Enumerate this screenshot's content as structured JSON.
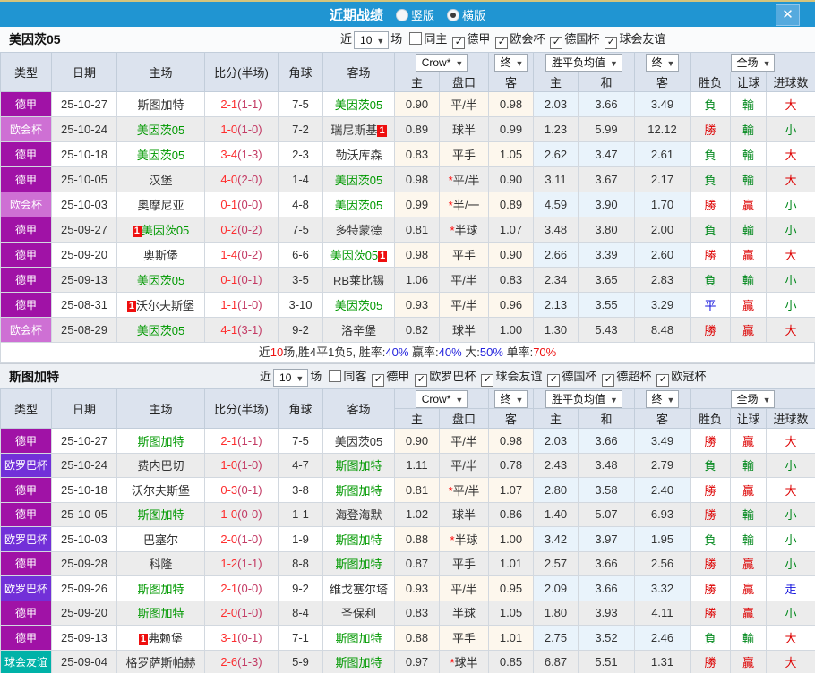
{
  "icons": {
    "dropdown_arrow": "▼",
    "close": "✕",
    "check": "✓"
  },
  "colors": {
    "topbar": "#2095d2",
    "topbar_strip": "#d5c47b",
    "close_button": "#55aade",
    "focus_team_green": "#009900",
    "score_red": "#ff2d2d",
    "half_score": "#c33a64",
    "win_red": "#dd0000",
    "lose_green": "#00881b",
    "draw_blue": "#1515dd",
    "league_colors": {
      "德甲": "#a012a6",
      "欧会杯": "#ce70d4",
      "欧罗巴杯": "#7230d8",
      "球会友谊": "#00b2a8"
    }
  },
  "topbar": {
    "title": "近期战绩",
    "options": [
      {
        "label": "竖版",
        "selected": false
      },
      {
        "label": "横版",
        "selected": true
      }
    ]
  },
  "columns_left": [
    "类型",
    "日期",
    "主场",
    "比分(半场)",
    "角球",
    "客场"
  ],
  "columns_right": [
    "主",
    "盘口",
    "客",
    "主",
    "和",
    "客",
    "胜负",
    "让球",
    "进球数"
  ],
  "header_dropdowns": [
    "Crow*",
    "终",
    "胜平负均值",
    "终",
    "全场"
  ],
  "tables": [
    {
      "team": "美因茨05",
      "filter": {
        "near": "近",
        "count": "10",
        "games": "场",
        "same": {
          "label": "同主",
          "checked": false
        },
        "leagues": [
          {
            "label": "德甲",
            "checked": true
          },
          {
            "label": "欧会杯",
            "checked": true
          },
          {
            "label": "德国杯",
            "checked": true
          },
          {
            "label": "球会友谊",
            "checked": true
          }
        ]
      },
      "rows": [
        {
          "type": "德甲",
          "date": "25-10-27",
          "home": "斯图加特",
          "home_focus": false,
          "home_card": false,
          "score": "2-1",
          "half": "(1-1)",
          "corners": "7-5",
          "away": "美因茨05",
          "away_focus": true,
          "away_card": false,
          "odds": [
            "0.90",
            "平/半",
            "0.98"
          ],
          "handicap_star": false,
          "avg": [
            "2.03",
            "3.66",
            "3.49"
          ],
          "results": [
            "負",
            "輸",
            "大"
          ]
        },
        {
          "type": "欧会杯",
          "date": "25-10-24",
          "home": "美因茨05",
          "home_focus": true,
          "home_card": false,
          "score": "1-0",
          "half": "(1-0)",
          "corners": "7-2",
          "away": "瑞尼斯基",
          "away_focus": false,
          "away_card": true,
          "odds": [
            "0.89",
            "球半",
            "0.99"
          ],
          "handicap_star": false,
          "avg": [
            "1.23",
            "5.99",
            "12.12"
          ],
          "results": [
            "勝",
            "輸",
            "小"
          ]
        },
        {
          "type": "德甲",
          "date": "25-10-18",
          "home": "美因茨05",
          "home_focus": true,
          "home_card": false,
          "score": "3-4",
          "half": "(1-3)",
          "corners": "2-3",
          "away": "勒沃库森",
          "away_focus": false,
          "away_card": false,
          "odds": [
            "0.83",
            "平手",
            "1.05"
          ],
          "handicap_star": false,
          "avg": [
            "2.62",
            "3.47",
            "2.61"
          ],
          "results": [
            "負",
            "輸",
            "大"
          ]
        },
        {
          "type": "德甲",
          "date": "25-10-05",
          "home": "汉堡",
          "home_focus": false,
          "home_card": false,
          "score": "4-0",
          "half": "(2-0)",
          "corners": "1-4",
          "away": "美因茨05",
          "away_focus": true,
          "away_card": false,
          "odds": [
            "0.98",
            "平/半",
            "0.90"
          ],
          "handicap_star": true,
          "avg": [
            "3.11",
            "3.67",
            "2.17"
          ],
          "results": [
            "負",
            "輸",
            "大"
          ]
        },
        {
          "type": "欧会杯",
          "date": "25-10-03",
          "home": "奥摩尼亚",
          "home_focus": false,
          "home_card": false,
          "score": "0-1",
          "half": "(0-0)",
          "corners": "4-8",
          "away": "美因茨05",
          "away_focus": true,
          "away_card": false,
          "odds": [
            "0.99",
            "半/一",
            "0.89"
          ],
          "handicap_star": true,
          "avg": [
            "4.59",
            "3.90",
            "1.70"
          ],
          "results": [
            "勝",
            "贏",
            "小"
          ]
        },
        {
          "type": "德甲",
          "date": "25-09-27",
          "home": "美因茨05",
          "home_focus": true,
          "home_card": true,
          "score": "0-2",
          "half": "(0-2)",
          "corners": "7-5",
          "away": "多特蒙德",
          "away_focus": false,
          "away_card": false,
          "odds": [
            "0.81",
            "半球",
            "1.07"
          ],
          "handicap_star": true,
          "avg": [
            "3.48",
            "3.80",
            "2.00"
          ],
          "results": [
            "負",
            "輸",
            "小"
          ]
        },
        {
          "type": "德甲",
          "date": "25-09-20",
          "home": "奥斯堡",
          "home_focus": false,
          "home_card": false,
          "score": "1-4",
          "half": "(0-2)",
          "corners": "6-6",
          "away": "美因茨05",
          "away_focus": true,
          "away_card": true,
          "odds": [
            "0.98",
            "平手",
            "0.90"
          ],
          "handicap_star": false,
          "avg": [
            "2.66",
            "3.39",
            "2.60"
          ],
          "results": [
            "勝",
            "贏",
            "大"
          ]
        },
        {
          "type": "德甲",
          "date": "25-09-13",
          "home": "美因茨05",
          "home_focus": true,
          "home_card": false,
          "score": "0-1",
          "half": "(0-1)",
          "corners": "3-5",
          "away": "RB莱比锡",
          "away_focus": false,
          "away_card": false,
          "odds": [
            "1.06",
            "平/半",
            "0.83"
          ],
          "handicap_star": false,
          "avg": [
            "2.34",
            "3.65",
            "2.83"
          ],
          "results": [
            "負",
            "輸",
            "小"
          ]
        },
        {
          "type": "德甲",
          "date": "25-08-31",
          "home": "沃尔夫斯堡",
          "home_focus": false,
          "home_card": true,
          "score": "1-1",
          "half": "(1-0)",
          "corners": "3-10",
          "away": "美因茨05",
          "away_focus": true,
          "away_card": false,
          "odds": [
            "0.93",
            "平/半",
            "0.96"
          ],
          "handicap_star": false,
          "avg": [
            "2.13",
            "3.55",
            "3.29"
          ],
          "results": [
            "平",
            "贏",
            "小"
          ]
        },
        {
          "type": "欧会杯",
          "date": "25-08-29",
          "home": "美因茨05",
          "home_focus": true,
          "home_card": false,
          "score": "4-1",
          "half": "(3-1)",
          "corners": "9-2",
          "away": "洛辛堡",
          "away_focus": false,
          "away_card": false,
          "odds": [
            "0.82",
            "球半",
            "1.00"
          ],
          "handicap_star": false,
          "avg": [
            "1.30",
            "5.43",
            "8.48"
          ],
          "results": [
            "勝",
            "贏",
            "大"
          ]
        }
      ],
      "summary": [
        {
          "text": "近",
          "color": "black"
        },
        {
          "text": "10",
          "color": "red"
        },
        {
          "text": "场,胜4平1负5, 胜率:",
          "color": "black"
        },
        {
          "text": "40%",
          "color": "blue"
        },
        {
          "text": " 赢率:",
          "color": "black"
        },
        {
          "text": "40%",
          "color": "blue"
        },
        {
          "text": " 大:",
          "color": "black"
        },
        {
          "text": "50%",
          "color": "blue"
        },
        {
          "text": " 单率:",
          "color": "black"
        },
        {
          "text": "70%",
          "color": "red"
        }
      ]
    },
    {
      "team": "斯图加特",
      "filter": {
        "near": "近",
        "count": "10",
        "games": "场",
        "same": {
          "label": "同客",
          "checked": false
        },
        "leagues": [
          {
            "label": "德甲",
            "checked": true
          },
          {
            "label": "欧罗巴杯",
            "checked": true
          },
          {
            "label": "球会友谊",
            "checked": true
          },
          {
            "label": "德国杯",
            "checked": true
          },
          {
            "label": "德超杯",
            "checked": true
          },
          {
            "label": "欧冠杯",
            "checked": true
          }
        ]
      },
      "rows": [
        {
          "type": "德甲",
          "date": "25-10-27",
          "home": "斯图加特",
          "home_focus": true,
          "home_card": false,
          "score": "2-1",
          "half": "(1-1)",
          "corners": "7-5",
          "away": "美因茨05",
          "away_focus": false,
          "away_card": false,
          "odds": [
            "0.90",
            "平/半",
            "0.98"
          ],
          "handicap_star": false,
          "avg": [
            "2.03",
            "3.66",
            "3.49"
          ],
          "results": [
            "勝",
            "贏",
            "大"
          ]
        },
        {
          "type": "欧罗巴杯",
          "date": "25-10-24",
          "home": "费内巴切",
          "home_focus": false,
          "home_card": false,
          "score": "1-0",
          "half": "(1-0)",
          "corners": "4-7",
          "away": "斯图加特",
          "away_focus": true,
          "away_card": false,
          "odds": [
            "1.11",
            "平/半",
            "0.78"
          ],
          "handicap_star": false,
          "avg": [
            "2.43",
            "3.48",
            "2.79"
          ],
          "results": [
            "負",
            "輸",
            "小"
          ]
        },
        {
          "type": "德甲",
          "date": "25-10-18",
          "home": "沃尔夫斯堡",
          "home_focus": false,
          "home_card": false,
          "score": "0-3",
          "half": "(0-1)",
          "corners": "3-8",
          "away": "斯图加特",
          "away_focus": true,
          "away_card": false,
          "odds": [
            "0.81",
            "平/半",
            "1.07"
          ],
          "handicap_star": true,
          "avg": [
            "2.80",
            "3.58",
            "2.40"
          ],
          "results": [
            "勝",
            "贏",
            "大"
          ]
        },
        {
          "type": "德甲",
          "date": "25-10-05",
          "home": "斯图加特",
          "home_focus": true,
          "home_card": false,
          "score": "1-0",
          "half": "(0-0)",
          "corners": "1-1",
          "away": "海登海默",
          "away_focus": false,
          "away_card": false,
          "odds": [
            "1.02",
            "球半",
            "0.86"
          ],
          "handicap_star": false,
          "avg": [
            "1.40",
            "5.07",
            "6.93"
          ],
          "results": [
            "勝",
            "輸",
            "小"
          ]
        },
        {
          "type": "欧罗巴杯",
          "date": "25-10-03",
          "home": "巴塞尔",
          "home_focus": false,
          "home_card": false,
          "score": "2-0",
          "half": "(1-0)",
          "corners": "1-9",
          "away": "斯图加特",
          "away_focus": true,
          "away_card": false,
          "odds": [
            "0.88",
            "半球",
            "1.00"
          ],
          "handicap_star": true,
          "avg": [
            "3.42",
            "3.97",
            "1.95"
          ],
          "results": [
            "負",
            "輸",
            "小"
          ]
        },
        {
          "type": "德甲",
          "date": "25-09-28",
          "home": "科隆",
          "home_focus": false,
          "home_card": false,
          "score": "1-2",
          "half": "(1-1)",
          "corners": "8-8",
          "away": "斯图加特",
          "away_focus": true,
          "away_card": false,
          "odds": [
            "0.87",
            "平手",
            "1.01"
          ],
          "handicap_star": false,
          "avg": [
            "2.57",
            "3.66",
            "2.56"
          ],
          "results": [
            "勝",
            "贏",
            "小"
          ]
        },
        {
          "type": "欧罗巴杯",
          "date": "25-09-26",
          "home": "斯图加特",
          "home_focus": true,
          "home_card": false,
          "score": "2-1",
          "half": "(0-0)",
          "corners": "9-2",
          "away": "维戈塞尔塔",
          "away_focus": false,
          "away_card": false,
          "odds": [
            "0.93",
            "平/半",
            "0.95"
          ],
          "handicap_star": false,
          "avg": [
            "2.09",
            "3.66",
            "3.32"
          ],
          "results": [
            "勝",
            "贏",
            "走"
          ]
        },
        {
          "type": "德甲",
          "date": "25-09-20",
          "home": "斯图加特",
          "home_focus": true,
          "home_card": false,
          "score": "2-0",
          "half": "(1-0)",
          "corners": "8-4",
          "away": "圣保利",
          "away_focus": false,
          "away_card": false,
          "odds": [
            "0.83",
            "半球",
            "1.05"
          ],
          "handicap_star": false,
          "avg": [
            "1.80",
            "3.93",
            "4.11"
          ],
          "results": [
            "勝",
            "贏",
            "小"
          ]
        },
        {
          "type": "德甲",
          "date": "25-09-13",
          "home": "弗赖堡",
          "home_focus": false,
          "home_card": true,
          "score": "3-1",
          "half": "(0-1)",
          "corners": "7-1",
          "away": "斯图加特",
          "away_focus": true,
          "away_card": false,
          "odds": [
            "0.88",
            "平手",
            "1.01"
          ],
          "handicap_star": false,
          "avg": [
            "2.75",
            "3.52",
            "2.46"
          ],
          "results": [
            "負",
            "輸",
            "大"
          ]
        },
        {
          "type": "球会友谊",
          "date": "25-09-04",
          "home": "格罗萨斯帕赫",
          "home_focus": false,
          "home_card": false,
          "score": "2-6",
          "half": "(1-3)",
          "corners": "5-9",
          "away": "斯图加特",
          "away_focus": true,
          "away_card": false,
          "odds": [
            "0.97",
            "球半",
            "0.85"
          ],
          "handicap_star": true,
          "avg": [
            "6.87",
            "5.51",
            "1.31"
          ],
          "results": [
            "勝",
            "贏",
            "大"
          ]
        }
      ]
    }
  ]
}
